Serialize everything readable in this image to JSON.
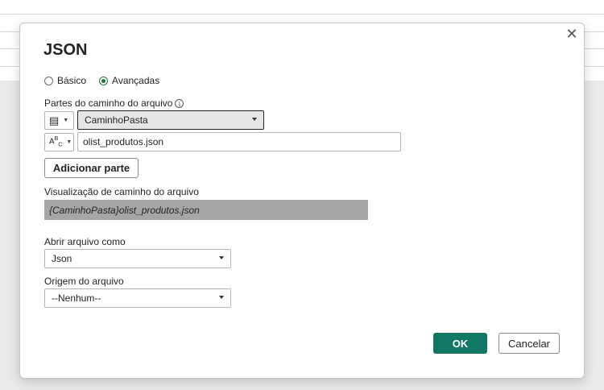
{
  "dialog": {
    "title": "JSON",
    "close_glyph": "✕"
  },
  "mode": {
    "options": [
      {
        "label": "Básico",
        "checked": false
      },
      {
        "label": "Avançadas",
        "checked": true
      }
    ]
  },
  "path_parts": {
    "label": "Partes do caminho do arquivo",
    "info_glyph": "i",
    "rows": [
      {
        "type_icon": "table-icon",
        "type_glyph": "▤",
        "value": "CaminhoPasta",
        "kind": "parameter"
      },
      {
        "type_icon": "text-type-icon",
        "type_glyph": "Aᴮᴄ",
        "value": "olist_produtos.json",
        "kind": "text"
      }
    ],
    "add_button": "Adicionar parte"
  },
  "preview": {
    "label": "Visualização de caminho do arquivo",
    "value": "{CaminhoPasta}olist_produtos.json"
  },
  "open_as": {
    "label": "Abrir arquivo como",
    "value": "Json"
  },
  "file_origin": {
    "label": "Origem do arquivo",
    "value": "--Nenhum--"
  },
  "actions": {
    "ok": "OK",
    "cancel": "Cancelar"
  },
  "colors": {
    "accent": "#117865",
    "radio_checked": "#217346",
    "preview_bg": "#a6a6a6"
  }
}
